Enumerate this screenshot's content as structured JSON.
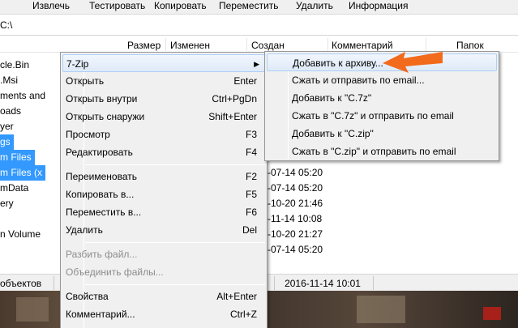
{
  "toolbar": {
    "items": [
      "Извлечь",
      "Тестировать",
      "Копировать",
      "Переместить",
      "Удалить",
      "Информация"
    ]
  },
  "path": "C:\\",
  "columns": [
    "Размер",
    "Изменен",
    "Создан",
    "Комментарий",
    "Папок"
  ],
  "files": [
    {
      "name": "cle.Bin",
      "date": "",
      "selected": false
    },
    {
      "name": ".Msi",
      "date": "",
      "selected": false
    },
    {
      "name": "ments and",
      "date": "",
      "selected": false
    },
    {
      "name": "oads",
      "date": "",
      "selected": false
    },
    {
      "name": "yer",
      "date": "",
      "selected": false
    },
    {
      "name": "gs",
      "date": "",
      "selected": true
    },
    {
      "name": "m Files",
      "date": "",
      "selected": true
    },
    {
      "name": "m Files (x",
      "date": "-07-14 05:20",
      "selected": true
    },
    {
      "name": "mData",
      "date": "-07-14 05:20",
      "selected": false
    },
    {
      "name": "ery",
      "date": "-10-20 21:46",
      "selected": false
    },
    {
      "name": "",
      "date": "-11-14 10:08",
      "selected": false
    },
    {
      "name": "n Volume",
      "date": "-10-20 21:27",
      "selected": false
    },
    {
      "name": "",
      "date": "-07-14 05:20",
      "selected": false
    }
  ],
  "status": {
    "left": "объектов",
    "mid": "2016-11-14 10:01"
  },
  "context_menu": {
    "items": [
      {
        "label": "7-Zip",
        "shortcut": "",
        "submenu": true,
        "highlighted": true,
        "disabled": false
      },
      {
        "label": "Открыть",
        "shortcut": "Enter",
        "submenu": false,
        "highlighted": false,
        "disabled": false
      },
      {
        "label": "Открыть внутри",
        "shortcut": "Ctrl+PgDn",
        "submenu": false,
        "highlighted": false,
        "disabled": false
      },
      {
        "label": "Открыть снаружи",
        "shortcut": "Shift+Enter",
        "submenu": false,
        "highlighted": false,
        "disabled": false
      },
      {
        "label": "Просмотр",
        "shortcut": "F3",
        "submenu": false,
        "highlighted": false,
        "disabled": false
      },
      {
        "label": "Редактировать",
        "shortcut": "F4",
        "submenu": false,
        "highlighted": false,
        "disabled": false
      },
      {
        "label": "Переименовать",
        "shortcut": "F2",
        "submenu": false,
        "highlighted": false,
        "disabled": false
      },
      {
        "label": "Копировать в...",
        "shortcut": "F5",
        "submenu": false,
        "highlighted": false,
        "disabled": false
      },
      {
        "label": "Переместить в...",
        "shortcut": "F6",
        "submenu": false,
        "highlighted": false,
        "disabled": false
      },
      {
        "label": "Удалить",
        "shortcut": "Del",
        "submenu": false,
        "highlighted": false,
        "disabled": false
      },
      {
        "label": "Разбить файл...",
        "shortcut": "",
        "submenu": false,
        "highlighted": false,
        "disabled": true
      },
      {
        "label": "Объединить файлы...",
        "shortcut": "",
        "submenu": false,
        "highlighted": false,
        "disabled": true
      },
      {
        "label": "Свойства",
        "shortcut": "Alt+Enter",
        "submenu": false,
        "highlighted": false,
        "disabled": false
      },
      {
        "label": "Комментарий...",
        "shortcut": "Ctrl+Z",
        "submenu": false,
        "highlighted": false,
        "disabled": false
      }
    ]
  },
  "submenu": {
    "items": [
      {
        "label": "Добавить к архиву...",
        "highlighted": true
      },
      {
        "label": "Сжать и отправить по email...",
        "highlighted": false
      },
      {
        "label": "Добавить к \"C.7z\"",
        "highlighted": false
      },
      {
        "label": "Сжать в \"C.7z\" и отправить по email",
        "highlighted": false
      },
      {
        "label": "Добавить к \"C.zip\"",
        "highlighted": false
      },
      {
        "label": "Сжать в \"C.zip\" и отправить по email",
        "highlighted": false
      }
    ]
  },
  "colors": {
    "selection": "#3399ff",
    "menu_bg": "#f0f0f0",
    "highlight": "#dfeaf8",
    "annotation_arrow": "#f26a1b"
  },
  "icons": [
    "submenu-arrow-icon",
    "annotation-arrow-icon"
  ]
}
